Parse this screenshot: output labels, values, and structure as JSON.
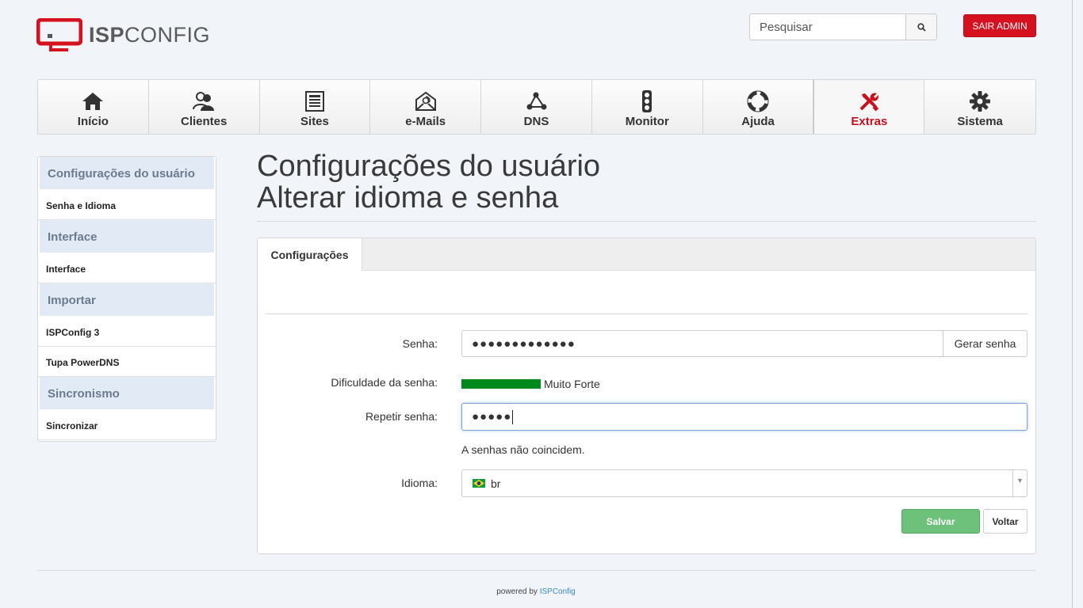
{
  "header": {
    "logo_text_bold": "ISP",
    "logo_text_light": "CONFIG",
    "search_placeholder": "Pesquisar",
    "logout_label": "SAIR ADMIN"
  },
  "nav": [
    {
      "label": "Início",
      "icon": "home-icon"
    },
    {
      "label": "Clientes",
      "icon": "users-icon"
    },
    {
      "label": "Sites",
      "icon": "newspaper-icon"
    },
    {
      "label": "e-Mails",
      "icon": "envelope-icon"
    },
    {
      "label": "DNS",
      "icon": "network-icon"
    },
    {
      "label": "Monitor",
      "icon": "traffic-light-icon"
    },
    {
      "label": "Ajuda",
      "icon": "lifebuoy-icon"
    },
    {
      "label": "Extras",
      "icon": "tools-icon",
      "active": true
    },
    {
      "label": "Sistema",
      "icon": "gear-icon"
    }
  ],
  "sidebar": {
    "sections": [
      {
        "heading": "Configurações do usuário",
        "links": [
          "Senha e Idioma"
        ]
      },
      {
        "heading": "Interface",
        "links": [
          "Interface"
        ]
      },
      {
        "heading": "Importar",
        "links": [
          "ISPConfig 3",
          "Tupa PowerDNS"
        ]
      },
      {
        "heading": "Sincronismo",
        "links": [
          "Sincronizar"
        ]
      }
    ]
  },
  "main": {
    "title_line1": "Configurações do usuário",
    "title_line2": "Alterar idioma e senha",
    "tab_label": "Configurações",
    "form": {
      "password_label": "Senha:",
      "password_value": "●●●●●●●●●●●●●",
      "generate_label": "Gerar senha",
      "strength_label": "Dificuldade da senha:",
      "strength_text": "Muito Forte",
      "strength_level": 1.0,
      "repeat_label": "Repetir senha:",
      "repeat_value": "●●●●●",
      "mismatch_text": "A senhas não coincidem.",
      "language_label": "Idioma:",
      "language_value": "br"
    },
    "save_label": "Salvar",
    "back_label": "Voltar"
  },
  "footer": {
    "prefix": "powered by",
    "link": "ISPConfig"
  },
  "colors": {
    "brand_red": "#c8101e",
    "strength_green": "#008a1c",
    "save_green": "#6dc17b",
    "sidebar_heading_bg": "#e2eaf6"
  }
}
